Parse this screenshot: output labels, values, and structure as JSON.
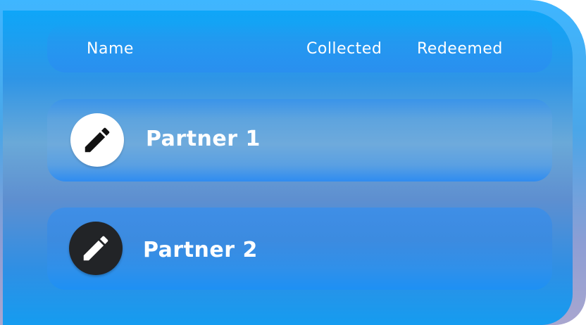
{
  "table": {
    "headers": {
      "name": "Name",
      "collected": "Collected",
      "redeemed": "Redeemed"
    },
    "rows": [
      {
        "name": "Partner 1",
        "icon": "edit-pencil-icon",
        "avatar_color": "#ffffff",
        "icon_color": "#111111"
      },
      {
        "name": "Partner 2",
        "icon": "edit-pencil-icon",
        "avatar_color": "#222427",
        "icon_color": "#ffffff"
      }
    ]
  },
  "colors": {
    "panel_top": "#0ea6f8",
    "panel_mid": "#6aa9d8",
    "text": "#ffffff"
  }
}
